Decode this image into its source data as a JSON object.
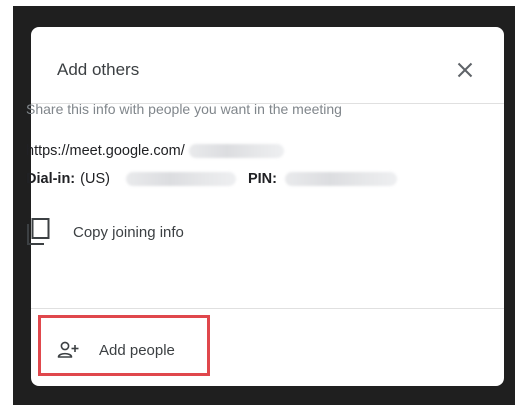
{
  "dialog": {
    "title": "Add others",
    "close_icon": "close-icon",
    "share_text": "Share this info with people you want in the meeting",
    "meet_link_prefix": "https://meet.google.com/",
    "dial_in_label": "Dial-in:",
    "dial_in_country": "(US)",
    "pin_label": "PIN:",
    "copy_label": "Copy joining info",
    "copy_icon": "copy-icon",
    "add_people_label": "Add people",
    "add_people_icon": "add-person-icon"
  },
  "colors": {
    "backdrop": "#1f1f1f",
    "dialog_bg": "#ffffff",
    "highlight": "#e0474c",
    "muted_text": "#80868b",
    "primary_text": "#202124"
  }
}
